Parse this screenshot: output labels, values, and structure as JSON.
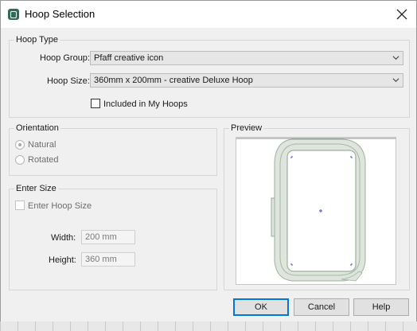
{
  "window": {
    "title": "Hoop Selection"
  },
  "hoop_type": {
    "legend": "Hoop Type",
    "group_label": "Hoop Group:",
    "group_value": "Pfaff creative icon",
    "size_label": "Hoop Size:",
    "size_value": "360mm x 200mm - creative Deluxe Hoop",
    "included_label": "Included in My Hoops"
  },
  "orientation": {
    "legend": "Orientation",
    "natural": "Natural",
    "rotated": "Rotated",
    "selected": "Natural"
  },
  "enter_size": {
    "legend": "Enter Size",
    "checkbox_label": "Enter Hoop Size",
    "width_label": "Width:",
    "width_value": "200 mm",
    "height_label": "Height:",
    "height_value": "360 mm"
  },
  "preview": {
    "legend": "Preview"
  },
  "buttons": {
    "ok": "OK",
    "cancel": "Cancel",
    "help": "Help"
  },
  "icons": [
    "app-icon",
    "close-icon",
    "chevron-down-icon"
  ]
}
